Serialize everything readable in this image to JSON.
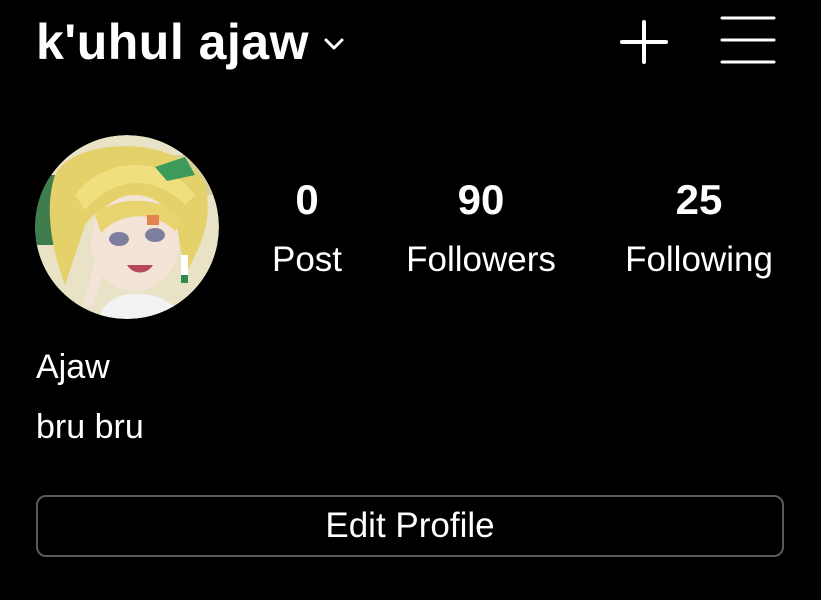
{
  "header": {
    "username": "k'uhul ajaw"
  },
  "profile": {
    "stats": [
      {
        "value": "0",
        "label": "Post"
      },
      {
        "value": "90",
        "label": "Followers"
      },
      {
        "value": "25",
        "label": "Following"
      }
    ],
    "display_name": "Ajaw",
    "bio": "bru bru",
    "edit_button": "Edit Profile"
  },
  "icons": {
    "username_dropdown": "chevron-down-icon",
    "create": "plus-icon",
    "menu": "hamburger-menu-icon"
  },
  "colors": {
    "background": "#000000",
    "text": "#ffffff",
    "button_border": "#5a5a5a"
  }
}
